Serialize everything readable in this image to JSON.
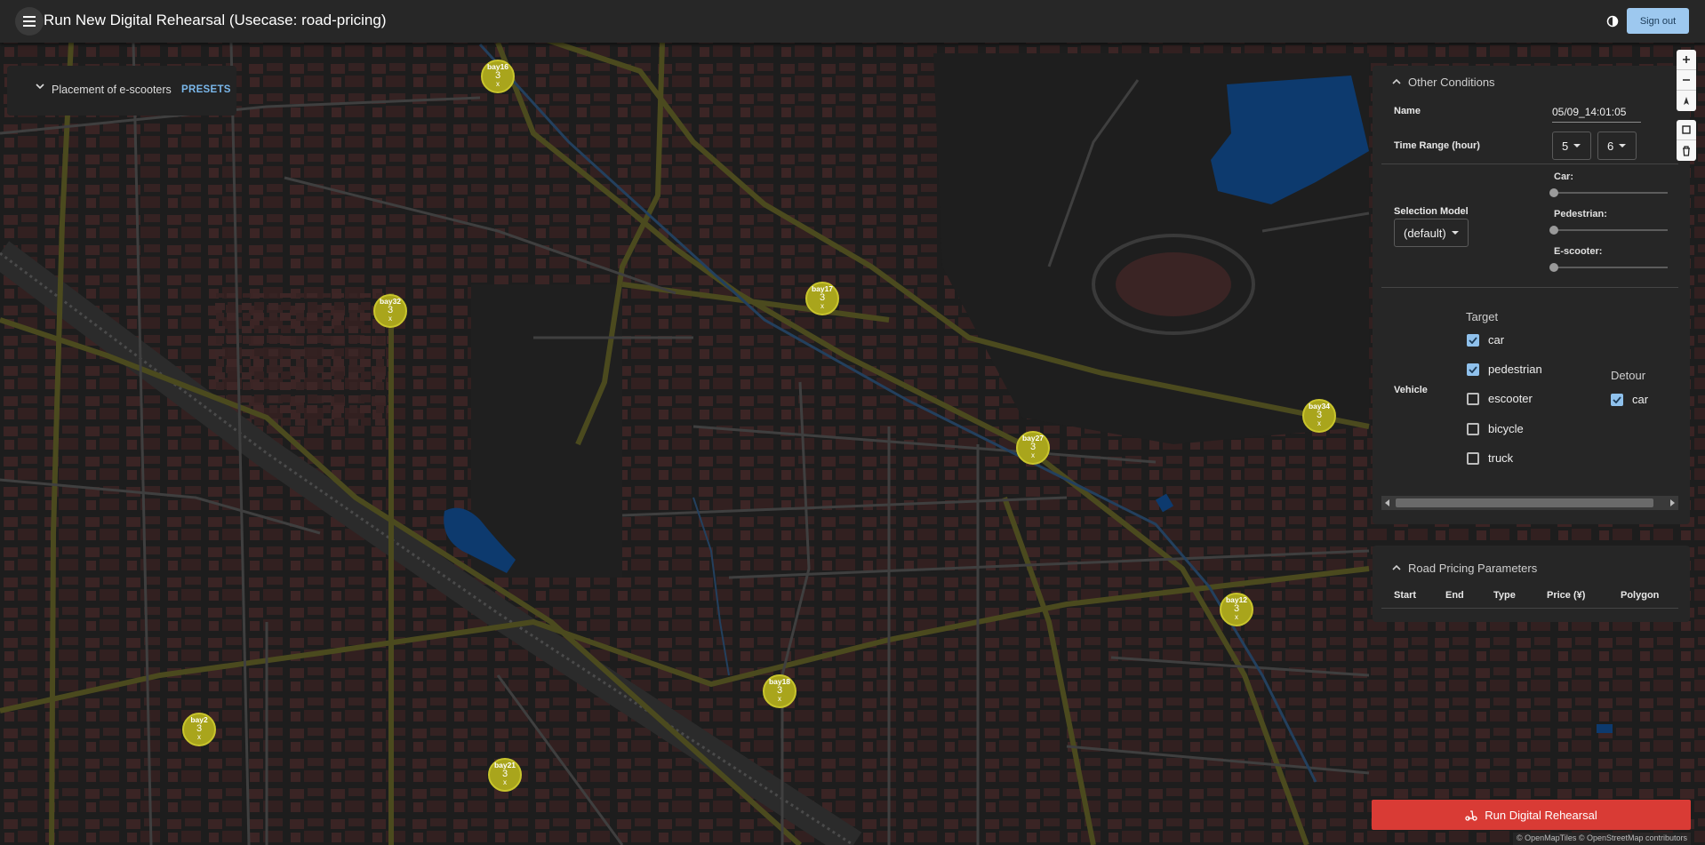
{
  "header": {
    "title": "Run New Digital Rehearsal (Usecase: road-pricing)",
    "sign_out_label": "Sign out"
  },
  "placement": {
    "label": "Placement of e-scooters",
    "presets_label": "PRESETS"
  },
  "markers": [
    {
      "name": "bay16",
      "count": "3",
      "sub": "x"
    },
    {
      "name": "bay32",
      "count": "3",
      "sub": "x"
    },
    {
      "name": "bay17",
      "count": "3",
      "sub": "x"
    },
    {
      "name": "bay27",
      "count": "3",
      "sub": "x"
    },
    {
      "name": "bay34",
      "count": "3",
      "sub": "x"
    },
    {
      "name": "bay12",
      "count": "3",
      "sub": "x"
    },
    {
      "name": "bay18",
      "count": "3",
      "sub": "x"
    },
    {
      "name": "bay2",
      "count": "3",
      "sub": "x"
    },
    {
      "name": "bay21",
      "count": "3",
      "sub": "x"
    }
  ],
  "other_conditions": {
    "title": "Other Conditions",
    "name_label": "Name",
    "name_value": "05/09_14:01:05",
    "time_range_label": "Time Range (hour)",
    "time_start": "5",
    "time_end": "6",
    "selection_model_label": "Selection Model",
    "selection_model_value": "(default)",
    "sliders": [
      {
        "label": "Car:",
        "value": 0
      },
      {
        "label": "Pedestrian:",
        "value": 0
      },
      {
        "label": "E-scooter:",
        "value": 0
      }
    ],
    "vehicle_label": "Vehicle",
    "target_title": "Target",
    "target_options": [
      {
        "label": "car",
        "checked": true
      },
      {
        "label": "pedestrian",
        "checked": true
      },
      {
        "label": "escooter",
        "checked": false
      },
      {
        "label": "bicycle",
        "checked": false
      },
      {
        "label": "truck",
        "checked": false
      }
    ],
    "detour_title": "Detour",
    "detour_options": [
      {
        "label": "car",
        "checked": true
      }
    ]
  },
  "road_pricing": {
    "title": "Road Pricing Parameters",
    "columns": [
      "Start",
      "End",
      "Type",
      "Price (¥)",
      "Polygon"
    ]
  },
  "run_button_label": "Run Digital Rehearsal",
  "attribution": "© OpenMapTiles © OpenStreetMap contributors",
  "colors": {
    "marker": "#a9a51c",
    "run_button": "#d93b35",
    "sign_out_bg": "#9dc8ef",
    "checkbox_checked": "#8fc1ec",
    "water": "#0d3a6e"
  }
}
